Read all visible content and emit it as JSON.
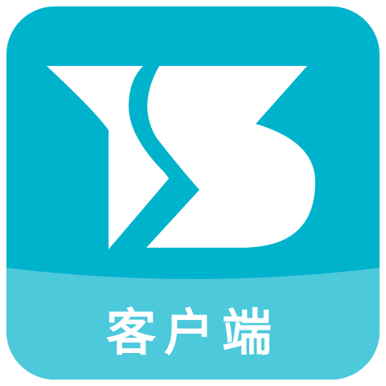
{
  "app_icon": {
    "logo": "TS-logo",
    "caption": "客户端",
    "colors": {
      "top_background": "#00B3CC",
      "bottom_background": "#4CC9DB",
      "logo_fill": "#FFFFFF",
      "caption_color": "#FFFFFF"
    }
  }
}
